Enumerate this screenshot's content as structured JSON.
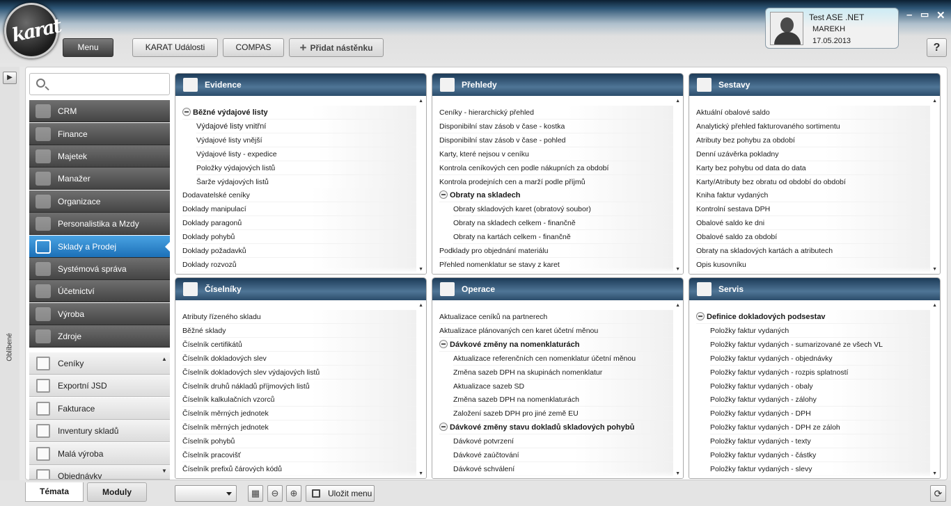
{
  "header": {
    "logo": "karat",
    "menu_label": "Menu",
    "karat_events": "KARAT Události",
    "compas": "COMPAS",
    "add_board": "Přidat nástěnku",
    "help": "?"
  },
  "user": {
    "name": "Test ASE .NET",
    "login": "MAREKH",
    "date": "17.05.2013"
  },
  "window_controls": {
    "minimize": "–",
    "restore": "▭",
    "close": "✕"
  },
  "favorites": {
    "label": "Oblíbené",
    "toggle": "▶"
  },
  "search": {
    "placeholder": ""
  },
  "sidebar": {
    "sections": [
      {
        "label": "CRM",
        "icon": "crm-icon"
      },
      {
        "label": "Finance",
        "icon": "money-bag-icon"
      },
      {
        "label": "Majetek",
        "icon": "building-icon"
      },
      {
        "label": "Manažer",
        "icon": "tie-icon"
      },
      {
        "label": "Organizace",
        "icon": "org-chart-icon"
      },
      {
        "label": "Personalistika a Mzdy",
        "icon": "person-icon"
      },
      {
        "label": "Sklady a Prodej",
        "icon": "export-icon",
        "active": true
      },
      {
        "label": "Systémová správa",
        "icon": "admin-icon"
      },
      {
        "label": "Účetnictví",
        "icon": "abacus-icon"
      },
      {
        "label": "Výroba",
        "icon": "factory-icon"
      },
      {
        "label": "Zdroje",
        "icon": "plug-icon"
      }
    ],
    "modules": [
      {
        "label": "Ceníky",
        "icon": "pricelist-icon"
      },
      {
        "label": "Exportní JSD",
        "icon": "export-jsd-icon"
      },
      {
        "label": "Fakturace",
        "icon": "invoice-icon"
      },
      {
        "label": "Inventury skladů",
        "icon": "inventory-icon"
      },
      {
        "label": "Malá výroba",
        "icon": "small-production-icon"
      },
      {
        "label": "Objednávky",
        "icon": "orders-icon"
      }
    ]
  },
  "panels": {
    "evidence": {
      "title": "Evidence",
      "icon": "cabinet-icon",
      "rows": [
        {
          "label": "Běžné výdajové listy",
          "type": "group"
        },
        {
          "label": "Výdajové listy vnitřní",
          "type": "child-strong"
        },
        {
          "label": "Výdajové listy vnější",
          "type": "child"
        },
        {
          "label": "Výdajové listy - expedice",
          "type": "child"
        },
        {
          "label": "Položky výdajových listů",
          "type": "child"
        },
        {
          "label": "Šarže výdajových listů",
          "type": "child"
        },
        {
          "label": "Dodavatelské ceníky",
          "type": "item"
        },
        {
          "label": "Doklady manipulací",
          "type": "item"
        },
        {
          "label": "Doklady paragonů",
          "type": "item"
        },
        {
          "label": "Doklady pohybů",
          "type": "item"
        },
        {
          "label": "Doklady požadavků",
          "type": "item"
        },
        {
          "label": "Doklady rozvozů",
          "type": "item"
        }
      ]
    },
    "prehledy": {
      "title": "Přehledy",
      "icon": "bar-chart-icon",
      "rows": [
        {
          "label": "Ceníky - hierarchický přehled",
          "type": "item"
        },
        {
          "label": "Disponibilní stav zásob v čase - kostka",
          "type": "item"
        },
        {
          "label": "Disponibilní stav zásob v čase - pohled",
          "type": "item"
        },
        {
          "label": "Karty, které nejsou v ceníku",
          "type": "item"
        },
        {
          "label": "Kontrola ceníkových cen podle nákupních za období",
          "type": "item"
        },
        {
          "label": "Kontrola prodejních cen a marží podle příjmů",
          "type": "item"
        },
        {
          "label": "Obraty na skladech",
          "type": "group"
        },
        {
          "label": "Obraty skladových karet (obratový soubor)",
          "type": "child"
        },
        {
          "label": "Obraty na skladech celkem - finančně",
          "type": "child"
        },
        {
          "label": "Obraty na kartách celkem - finančně",
          "type": "child"
        },
        {
          "label": "Podklady pro objednání materiálu",
          "type": "item"
        },
        {
          "label": "Přehled nomenklatur se stavy z karet",
          "type": "item"
        }
      ]
    },
    "sestavy": {
      "title": "Sestavy",
      "icon": "stack-icon",
      "rows": [
        {
          "label": "Aktuální obalové saldo",
          "type": "item"
        },
        {
          "label": "Analytický přehled fakturovaného sortimentu",
          "type": "item"
        },
        {
          "label": "Atributy bez pohybu za období",
          "type": "item"
        },
        {
          "label": "Denní uzávěrka pokladny",
          "type": "item"
        },
        {
          "label": "Karty bez pohybu od data do data",
          "type": "item"
        },
        {
          "label": "Karty/Atributy bez obratu od období do období",
          "type": "item"
        },
        {
          "label": "Kniha faktur vydaných",
          "type": "item"
        },
        {
          "label": "Kontrolní sestava DPH",
          "type": "item"
        },
        {
          "label": "Obalové saldo ke dni",
          "type": "item"
        },
        {
          "label": "Obalové saldo za období",
          "type": "item"
        },
        {
          "label": "Obraty na skladových kartách a atributech",
          "type": "item"
        },
        {
          "label": "Opis kusovníku",
          "type": "item"
        }
      ]
    },
    "ciselniky": {
      "title": "Číselníky",
      "icon": "numbers-icon",
      "rows": [
        {
          "label": "Atributy řízeného skladu",
          "type": "item"
        },
        {
          "label": "Běžné sklady",
          "type": "item"
        },
        {
          "label": "Číselník certifikátů",
          "type": "item"
        },
        {
          "label": "Číselník dokladových slev",
          "type": "item"
        },
        {
          "label": "Číselník dokladových slev výdajových listů",
          "type": "item"
        },
        {
          "label": "Číselník druhů nákladů příjmových listů",
          "type": "item"
        },
        {
          "label": "Číselník kalkulačních vzorců",
          "type": "item"
        },
        {
          "label": "Číselník měrných jednotek",
          "type": "item"
        },
        {
          "label": "Číselník měrných jednotek",
          "type": "item"
        },
        {
          "label": "Číselník pohybů",
          "type": "item"
        },
        {
          "label": "Číselník pracovišť",
          "type": "item"
        },
        {
          "label": "Číselník prefixů čárových kódů",
          "type": "item"
        }
      ]
    },
    "operace": {
      "title": "Operace",
      "icon": "box-icon",
      "rows": [
        {
          "label": "Aktualizace ceníků na partnerech",
          "type": "item"
        },
        {
          "label": "Aktualizace plánovaných cen karet účetní měnou",
          "type": "item"
        },
        {
          "label": "Dávkové změny na nomenklaturách",
          "type": "group"
        },
        {
          "label": "Aktualizace referenčních cen nomenklatur účetní měnou",
          "type": "child"
        },
        {
          "label": "Změna sazeb DPH na skupinách nomenklatur",
          "type": "child"
        },
        {
          "label": "Aktualizace sazeb SD",
          "type": "child"
        },
        {
          "label": "Změna sazeb DPH na nomenklaturách",
          "type": "child"
        },
        {
          "label": "Založení sazeb DPH pro jiné země EU",
          "type": "child"
        },
        {
          "label": "Dávkové změny stavu dokladů skladových pohybů",
          "type": "group"
        },
        {
          "label": "Dávkové potvrzení",
          "type": "child"
        },
        {
          "label": "Dávkové zaúčtování",
          "type": "child"
        },
        {
          "label": "Dávkové schválení",
          "type": "child"
        }
      ]
    },
    "servis": {
      "title": "Servis",
      "icon": "tools-icon",
      "rows": [
        {
          "label": "Definice dokladových podsestav",
          "type": "group"
        },
        {
          "label": "Položky faktur vydaných",
          "type": "child"
        },
        {
          "label": "Položky faktur vydaných - sumarizované ze všech VL",
          "type": "child"
        },
        {
          "label": "Položky faktur vydaných - objednávky",
          "type": "child"
        },
        {
          "label": "Položky faktur vydaných - rozpis splatností",
          "type": "child"
        },
        {
          "label": "Položky faktur vydaných - obaly",
          "type": "child"
        },
        {
          "label": "Položky faktur vydaných - zálohy",
          "type": "child"
        },
        {
          "label": "Položky faktur vydaných - DPH",
          "type": "child"
        },
        {
          "label": "Položky faktur vydaných - DPH ze záloh",
          "type": "child"
        },
        {
          "label": "Položky faktur vydaných - texty",
          "type": "child"
        },
        {
          "label": "Položky faktur vydaných - částky",
          "type": "child"
        },
        {
          "label": "Položky faktur vydaných - slevy",
          "type": "child"
        }
      ]
    }
  },
  "bottom": {
    "tab_topics": "Témata",
    "tab_modules": "Moduly",
    "combo_value": "",
    "save_menu": "Uložit menu",
    "refresh": "⟳"
  }
}
